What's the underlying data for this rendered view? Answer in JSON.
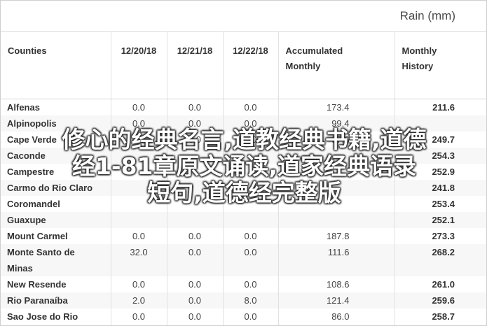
{
  "header": {
    "unit_label": "Rain (mm)"
  },
  "table": {
    "columns": {
      "county": "Counties",
      "d1": "12/20/18",
      "d2": "12/21/18",
      "d3": "12/22/18",
      "accumulated": [
        "Accumulated",
        "Monthly"
      ],
      "history": [
        "Monthly",
        "History"
      ]
    },
    "rows": [
      {
        "county": [
          "Alfenas"
        ],
        "d1": "0.0",
        "d2": "0.0",
        "d3": "0.0",
        "acc": "173.4",
        "hist": "211.6"
      },
      {
        "county": [
          "Alpinopolis"
        ],
        "d1": "0.0",
        "d2": "0.0",
        "d3": "0.0",
        "acc": "99.4",
        "hist": ""
      },
      {
        "county": [
          "Cape Verde"
        ],
        "d1": "1.2",
        "d2": "0.0",
        "d3": "0.0",
        "acc": "97.6",
        "hist": "249.7"
      },
      {
        "county": [
          "Caconde"
        ],
        "d1": "",
        "d2": "",
        "d3": "",
        "acc": "",
        "hist": "254.3"
      },
      {
        "county": [
          "Campestre"
        ],
        "d1": "",
        "d2": "",
        "d3": "",
        "acc": "",
        "hist": "252.9"
      },
      {
        "county": [
          "Carmo do Rio Claro"
        ],
        "d1": "",
        "d2": "",
        "d3": "",
        "acc": "",
        "hist": "241.8"
      },
      {
        "county": [
          "Coromandel"
        ],
        "d1": "",
        "d2": "",
        "d3": "",
        "acc": "",
        "hist": "253.4"
      },
      {
        "county": [
          "Guaxupe"
        ],
        "d1": "",
        "d2": "",
        "d3": "",
        "acc": "",
        "hist": "252.1"
      },
      {
        "county": [
          "Mount Carmel"
        ],
        "d1": "0.0",
        "d2": "0.0",
        "d3": "0.0",
        "acc": "187.8",
        "hist": "273.3"
      },
      {
        "county": [
          "Monte Santo de",
          "Minas"
        ],
        "d1": "32.0",
        "d2": "0.0",
        "d3": "0.0",
        "acc": "111.6",
        "hist": "268.2"
      },
      {
        "county": [
          "New Resende"
        ],
        "d1": "0.0",
        "d2": "0.0",
        "d3": "0.0",
        "acc": "108.6",
        "hist": "261.0"
      },
      {
        "county": [
          "Rio Paranaíba"
        ],
        "d1": "2.0",
        "d2": "0.0",
        "d3": "8.0",
        "acc": "121.4",
        "hist": "259.6"
      },
      {
        "county": [
          "Sao Jose do Rio",
          "Pardo"
        ],
        "d1": "0.0",
        "d2": "0.0",
        "d3": "0.0",
        "acc": "86.0",
        "hist": "258.7"
      }
    ]
  },
  "overlay": {
    "lines": [
      "修心的经典名言,道教经典书籍,道德",
      "经1-81章原文诵读,道家经典语录",
      "短句,道德经完整版"
    ]
  }
}
